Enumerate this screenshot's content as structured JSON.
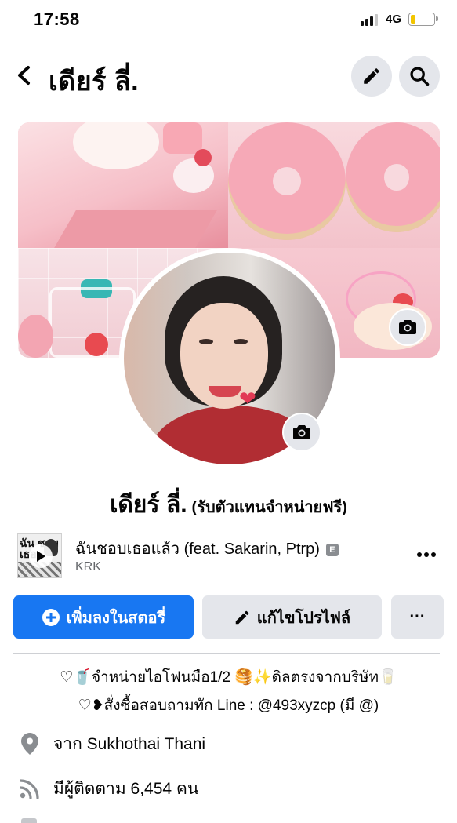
{
  "status_bar": {
    "time": "17:58",
    "network": "4G",
    "battery_level": 0.2
  },
  "header": {
    "title": "เดียร์ ลี่.",
    "back_icon": "chevron-left-icon",
    "edit_icon": "pencil-icon",
    "search_icon": "search-icon"
  },
  "profile": {
    "name": "เดียร์ ลี่.",
    "name_suffix": "(รับตัวแทนจำหน่ายฟรี)"
  },
  "song": {
    "title": "ฉันชอบเธอแล้ว (feat. Sakarin, Ptrp)",
    "explicit": "E",
    "artist": "KRK",
    "album_art_text": "ฉัน ชอบ เธอ"
  },
  "actions": {
    "add_story": "เพิ่มลงในสตอรี่",
    "edit_profile": "แก้ไขโปรไฟล์",
    "more": "···"
  },
  "bio": {
    "line1": "♡🥤จำหน่ายไอโฟนมือ1/2 🥞✨ดิลตรงจากบริษัท🥛",
    "line2": "♡❥สั่งซื้อสอบถามทัก Line : @493xyzcp (มี @)"
  },
  "details": {
    "location": "จาก Sukhothai Thani",
    "followers": "มีผู้ติดตาม 6,454 คน"
  },
  "colors": {
    "primary": "#1877f2",
    "button_gray": "#e4e6eb",
    "text": "#050505",
    "secondary_text": "#65676b"
  }
}
